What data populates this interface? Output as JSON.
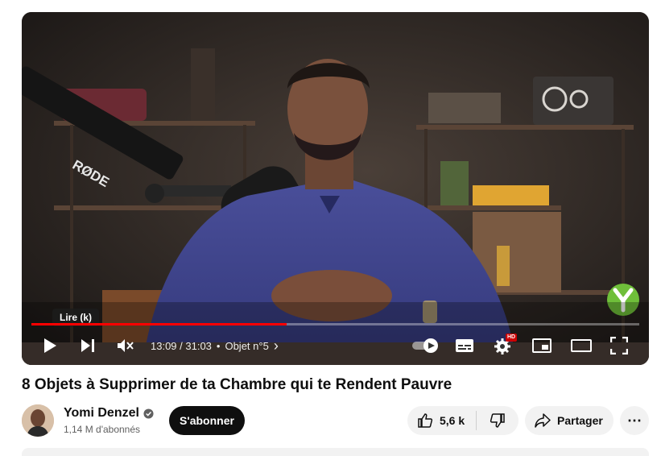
{
  "player": {
    "tooltip": "Lire (k)",
    "progress_fraction": 0.42,
    "time": "13:09 / 31:03",
    "separator": "•",
    "chapter": "Objet n°5",
    "chapter_arrow": "›",
    "quality_badge": "HD",
    "mic_brand": "RØDE",
    "icons": [
      "play-icon",
      "next-icon",
      "mute-icon",
      "autoplay-toggle",
      "subtitles-icon",
      "settings-icon",
      "miniplayer-icon",
      "theater-icon",
      "fullscreen-icon"
    ],
    "colors": {
      "progress": "#ff0000",
      "hd_badge": "#cc0000",
      "watermark": "#6fbf3a"
    }
  },
  "video": {
    "title": "8 Objets à Supprimer de ta Chambre qui te Rendent Pauvre"
  },
  "channel": {
    "name": "Yomi Denzel",
    "verified": true,
    "subscribers": "1,14 M d'abonnés",
    "subscribe_label": "S'abonner"
  },
  "actions": {
    "likes": "5,6 k",
    "share_label": "Partager",
    "more_label": "⋯"
  }
}
